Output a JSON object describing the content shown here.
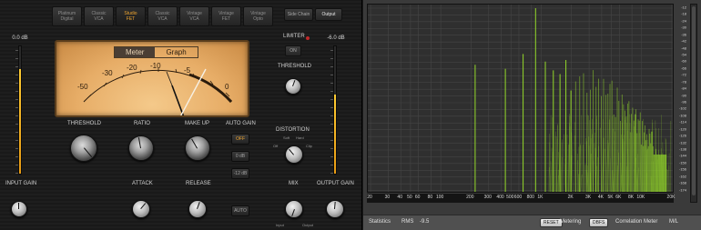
{
  "plugin": {
    "modes": [
      {
        "label": "Platinum\nDigital",
        "active": false
      },
      {
        "label": "Classic\nVCA",
        "active": false
      },
      {
        "label": "Studio\nFET",
        "active": true
      },
      {
        "label": "Classic\nVCA",
        "active": false
      },
      {
        "label": "Vintage\nVCA",
        "active": false
      },
      {
        "label": "Vintage\nFET",
        "active": false
      },
      {
        "label": "Vintage\nOpto",
        "active": false
      }
    ],
    "side_buttons": {
      "side_chain": "Side Chain",
      "output": "Output"
    },
    "input_readout": "0.0 dB",
    "output_readout": "-6.0 dB",
    "vu": {
      "meter_tab": "Meter",
      "graph_tab": "Graph",
      "scale": [
        "-50",
        "-30",
        "-20",
        "-10",
        "-5",
        "0"
      ]
    },
    "limiter": {
      "label": "LIMITER",
      "on_label": "ON",
      "threshold_label": "THRESHOLD"
    },
    "knobs": {
      "threshold": "THRESHOLD",
      "ratio": "RATIO",
      "make_up": "MAKE UP",
      "attack": "ATTACK",
      "release": "RELEASE",
      "mix": "MIX",
      "input_gain": "INPUT GAIN",
      "output_gain": "OUTPUT GAIN",
      "distortion": "DISTORTION"
    },
    "distortion_opts": {
      "soft": "Soft",
      "hard": "Hard",
      "off": "Off",
      "clip": "Clip"
    },
    "mix_ends": {
      "input": "Input",
      "output": "Output"
    },
    "auto_gain": {
      "label": "AUTO GAIN",
      "off": "OFF",
      "zero": "0 dB",
      "minus12": "-12 dB",
      "auto": "AUTO"
    },
    "input_meter_level": 0.82,
    "output_meter_level": 0.62
  },
  "analyzer": {
    "x_ticks": [
      "20",
      "30",
      "40",
      "50",
      "60",
      "80",
      "100",
      "200",
      "300",
      "400",
      "500",
      "600",
      "800",
      "1K",
      "2K",
      "3K",
      "4K",
      "5K",
      "6K",
      "8K",
      "10K",
      "20K"
    ],
    "y_ticks": [
      "-12",
      "-18",
      "-24",
      "-30",
      "-36",
      "-42",
      "-48",
      "-54",
      "-60",
      "-66",
      "-72",
      "-78",
      "-84",
      "-90",
      "-96",
      "-102",
      "-108",
      "-114",
      "-120",
      "-126",
      "-132",
      "-138",
      "-144",
      "-150",
      "-156",
      "-162",
      "-168",
      "-174"
    ],
    "trace_color": "#8fd12a",
    "status": {
      "statistics": "Statistics",
      "rms_label": "RMS",
      "rms_value": "-9.5",
      "reset": "RESET",
      "metering_label": "Metering",
      "metering_value": "DBFS",
      "correlation": "Correlation Meter",
      "mode": "M/L"
    }
  }
}
